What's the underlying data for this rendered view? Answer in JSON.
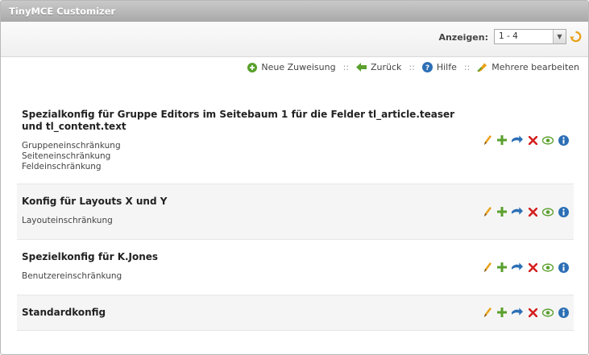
{
  "app": {
    "title": "TinyMCE Customizer"
  },
  "filter": {
    "label": "Anzeigen:",
    "value": "1 - 4"
  },
  "actions": {
    "new_label": "Neue Zuweisung",
    "back_label": "Zurück",
    "help_label": "Hilfe",
    "edit_multiple_label": "Mehrere bearbeiten",
    "separator": "::"
  },
  "rows": [
    {
      "title": "Spezialkonfig für Gruppe Editors im Seitebaum 1 für die Felder tl_article.teaser und tl_content.text",
      "subs": [
        "Gruppeneinschränkung",
        "Seiteneinschränkung",
        "Feldeinschränkung"
      ]
    },
    {
      "title": "Konfig für Layouts X und Y",
      "subs": [
        "Layouteinschränkung"
      ]
    },
    {
      "title": "Spezielkonfig für K.Jones",
      "subs": [
        "Benutzereinschränkung"
      ]
    },
    {
      "title": "Standardkonfig",
      "subs": []
    }
  ],
  "icons": {
    "edit": "pencil-icon",
    "add": "plus-icon",
    "move": "move-arrow-icon",
    "delete": "delete-x-icon",
    "toggle": "eye-icon",
    "info": "info-icon"
  },
  "colors": {
    "green": "#5aa02c",
    "red": "#d42020",
    "blue": "#2c6fb5",
    "orange": "#e8a11a"
  }
}
